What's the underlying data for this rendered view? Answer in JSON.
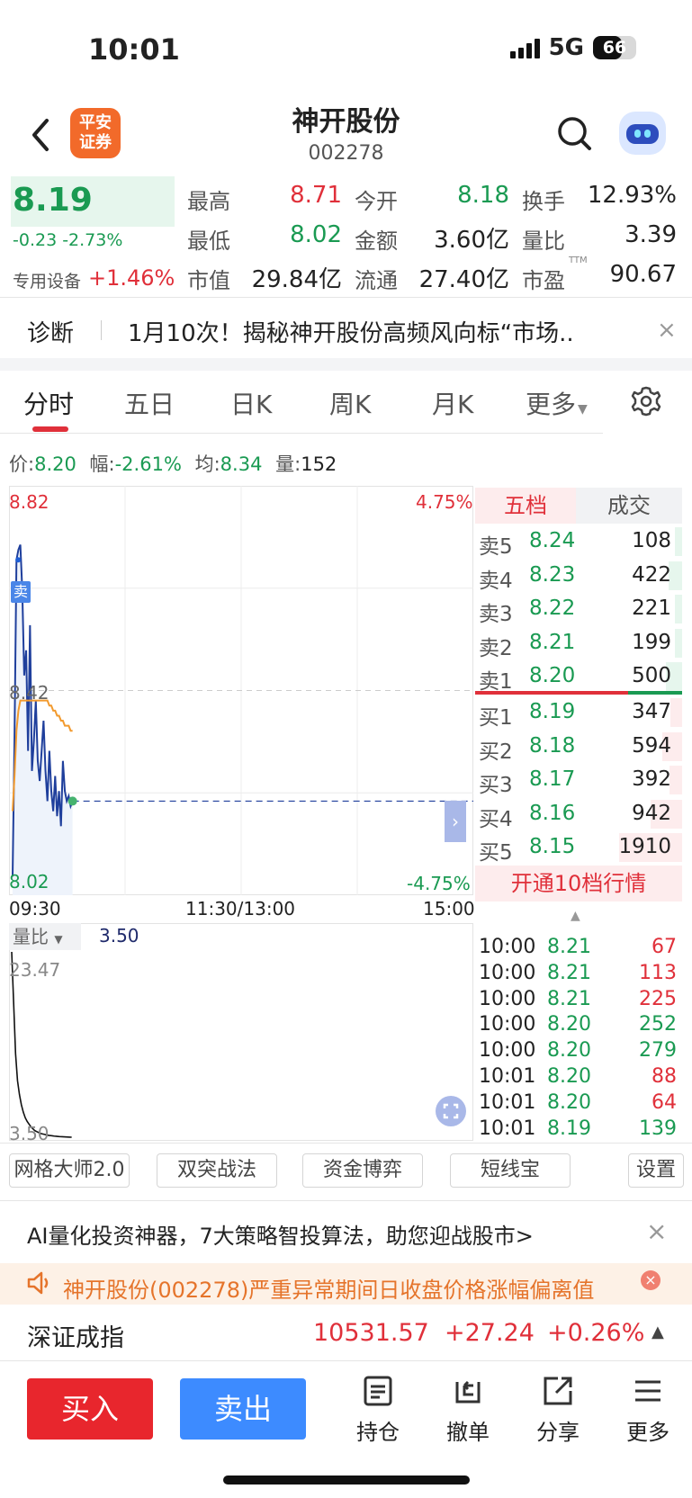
{
  "status": {
    "time": "10:01",
    "network": "5G",
    "battery": "66",
    "battery_level": 0.66
  },
  "header": {
    "logo_line1": "平安",
    "logo_line2": "证券",
    "title": "神开股份",
    "code": "002278"
  },
  "quote": {
    "price": "8.19",
    "change": "-0.23 -2.73%",
    "sector_label": "专用设备",
    "sector_change": "+1.46%",
    "rows": [
      [
        {
          "label": "最高",
          "value": "8.71",
          "color": "red"
        },
        {
          "label": "今开",
          "value": "8.18",
          "color": "green"
        },
        {
          "label": "换手",
          "value": "12.93%",
          "color": "dark"
        }
      ],
      [
        {
          "label": "最低",
          "value": "8.02",
          "color": "green"
        },
        {
          "label": "金额",
          "value": "3.60亿",
          "color": "dark"
        },
        {
          "label": "量比",
          "value": "3.39",
          "color": "dark"
        }
      ],
      [
        {
          "label": "市值",
          "value": "29.84亿",
          "color": "dark"
        },
        {
          "label": "流通",
          "value": "27.40亿",
          "color": "dark"
        },
        {
          "label": "市盈",
          "value": "90.67",
          "color": "dark"
        }
      ]
    ],
    "ttm": "TTM"
  },
  "diagnosis": {
    "label": "诊断",
    "text": "1月10次！揭秘神开股份高频风向标“市场..",
    "close": "×"
  },
  "tabs": [
    "分时",
    "五日",
    "日K",
    "周K",
    "月K",
    "更多"
  ],
  "info_row": {
    "price_label": "价:",
    "price": "8.20",
    "amp_label": "幅:",
    "amp": "-2.61%",
    "avg_label": "均:",
    "avg": "8.34",
    "vol_label": "量:",
    "vol": "152"
  },
  "chart": {
    "y_top": "8.82",
    "y_mid": "8.42",
    "y_bottom": "8.02",
    "pct_top": "4.75%",
    "pct_bottom": "-4.75%",
    "x_start": "09:30",
    "x_mid": "11:30/13:00",
    "x_end": "15:00",
    "sell_marker": "卖",
    "vol_label": "量比",
    "vol_value": "3.50",
    "vol_top": "23.47",
    "vol_bottom": "3.50"
  },
  "chart_data": {
    "type": "line",
    "x": [
      "09:30",
      "09:31",
      "09:32",
      "09:33",
      "09:34",
      "09:35",
      "09:36",
      "09:37",
      "09:38",
      "09:39",
      "09:40",
      "09:41",
      "09:42",
      "09:43",
      "09:44",
      "09:45",
      "09:46",
      "09:47",
      "09:48",
      "09:49",
      "09:50",
      "09:51",
      "09:52",
      "09:53",
      "09:54",
      "09:55",
      "09:56",
      "09:57",
      "09:58",
      "09:59",
      "10:00",
      "10:01"
    ],
    "series": [
      {
        "values": [
          8.05,
          8.33,
          8.68,
          8.7,
          8.71,
          8.62,
          8.45,
          8.5,
          8.3,
          8.55,
          8.26,
          8.32,
          8.4,
          8.28,
          8.24,
          8.3,
          8.36,
          8.26,
          8.2,
          8.3,
          8.22,
          8.18,
          8.25,
          8.17,
          8.22,
          8.15,
          8.28,
          8.22,
          8.2,
          8.21,
          8.19,
          8.2
        ]
      },
      {
        "values": [
          8.18,
          8.25,
          8.34,
          8.38,
          8.4,
          8.4,
          8.4,
          8.4,
          8.4,
          8.4,
          8.4,
          8.4,
          8.4,
          8.4,
          8.4,
          8.4,
          8.4,
          8.4,
          8.4,
          8.39,
          8.39,
          8.38,
          8.38,
          8.37,
          8.37,
          8.36,
          8.36,
          8.35,
          8.35,
          8.35,
          8.34,
          8.34
        ]
      }
    ],
    "prev_close": 8.42,
    "ylim": [
      8.02,
      8.82
    ],
    "vol_ratio": [
      23.47,
      18.0,
      12.5,
      9.6,
      8.1,
      7.0,
      6.2,
      5.6,
      5.2,
      4.9,
      4.6,
      4.4,
      4.2,
      4.1,
      4.0,
      3.9,
      3.85,
      3.8,
      3.75,
      3.7,
      3.68,
      3.65,
      3.62,
      3.6,
      3.58,
      3.56,
      3.55,
      3.54,
      3.53,
      3.52,
      3.51,
      3.5
    ],
    "vol_ylim": [
      3.5,
      23.47
    ]
  },
  "orderbook": {
    "tab_active": "五档",
    "tab_other": "成交",
    "asks": [
      {
        "label": "卖5",
        "price": "8.24",
        "vol": "108"
      },
      {
        "label": "卖4",
        "price": "8.23",
        "vol": "422"
      },
      {
        "label": "卖3",
        "price": "8.22",
        "vol": "221"
      },
      {
        "label": "卖2",
        "price": "8.21",
        "vol": "199"
      },
      {
        "label": "卖1",
        "price": "8.20",
        "vol": "500"
      }
    ],
    "bids": [
      {
        "label": "买1",
        "price": "8.19",
        "vol": "347"
      },
      {
        "label": "买2",
        "price": "8.18",
        "vol": "594"
      },
      {
        "label": "买3",
        "price": "8.17",
        "vol": "392"
      },
      {
        "label": "买4",
        "price": "8.16",
        "vol": "942"
      },
      {
        "label": "买5",
        "price": "8.15",
        "vol": "1910"
      }
    ],
    "upgrade": "开通10档行情",
    "ticks": [
      {
        "time": "10:00",
        "price": "8.21",
        "vol": "67",
        "color": "red"
      },
      {
        "time": "10:00",
        "price": "8.21",
        "vol": "113",
        "color": "red"
      },
      {
        "time": "10:00",
        "price": "8.21",
        "vol": "225",
        "color": "red"
      },
      {
        "time": "10:00",
        "price": "8.20",
        "vol": "252",
        "color": "green"
      },
      {
        "time": "10:00",
        "price": "8.20",
        "vol": "279",
        "color": "green"
      },
      {
        "time": "10:01",
        "price": "8.20",
        "vol": "88",
        "color": "red"
      },
      {
        "time": "10:01",
        "price": "8.20",
        "vol": "64",
        "color": "red"
      },
      {
        "time": "10:01",
        "price": "8.19",
        "vol": "139",
        "color": "green"
      }
    ]
  },
  "tools": [
    "网格大师2.0",
    "双突战法",
    "资金博弈",
    "短线宝",
    "设置"
  ],
  "ad": {
    "text": "AI量化投资神器，7大策略智投算法，助您迎战股市>",
    "close": "×"
  },
  "notice": {
    "text": "神开股份(002278)严重异常期间日收盘价格涨幅偏离值",
    "close": "×"
  },
  "index": {
    "name": "深证成指",
    "value": "10531.57",
    "change": "+27.24",
    "pct": "+0.26%",
    "arrow": "▲"
  },
  "bottom": {
    "buy": "买入",
    "sell": "卖出",
    "items": [
      "持仓",
      "撤单",
      "分享",
      "更多"
    ]
  },
  "colors": {
    "red": "#e0303a",
    "green": "#1a9a52",
    "blue": "#3d8bff",
    "line": "#1f3f9c",
    "avg": "#f29a2e"
  }
}
